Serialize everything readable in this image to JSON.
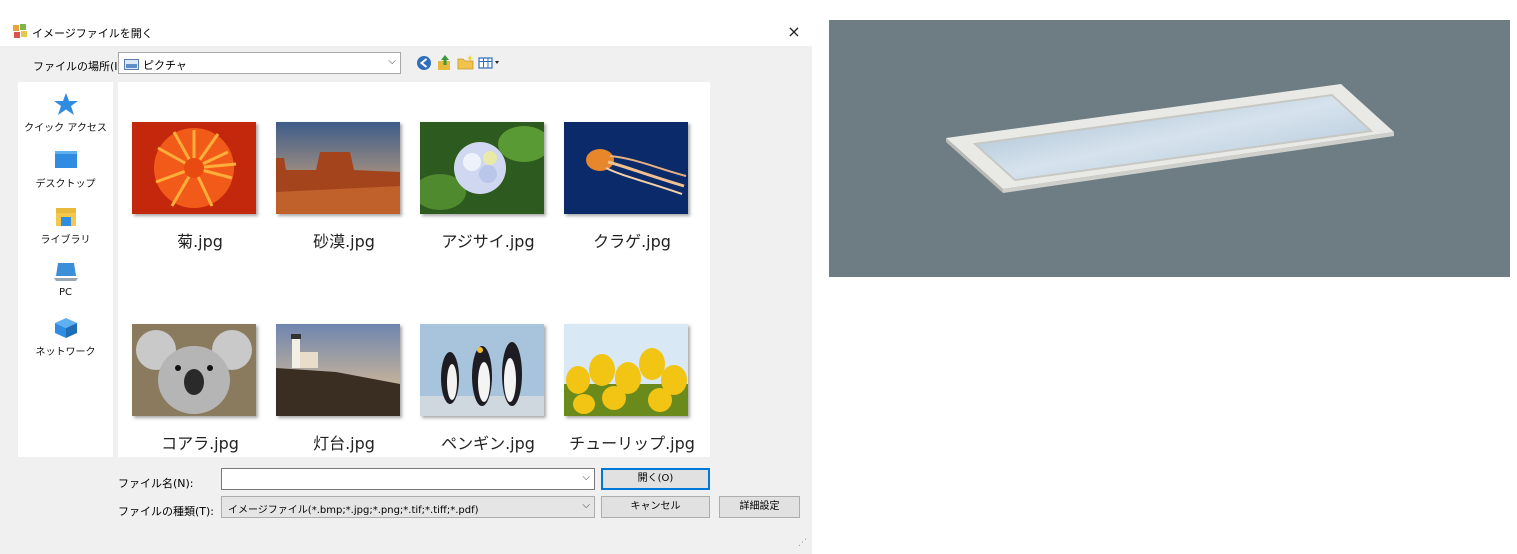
{
  "dialog": {
    "title": "イメージファイルを開く",
    "close_icon": "×",
    "look_in": {
      "label": "ファイルの場所(I):",
      "value": "ピクチャ",
      "icon": "pictures-folder-icon"
    },
    "toolbar_icons": [
      "back-icon",
      "up-folder-icon",
      "new-folder-icon",
      "view-menu-icon"
    ],
    "places": [
      {
        "label": "クイック アクセス",
        "icon": "star-icon"
      },
      {
        "label": "デスクトップ",
        "icon": "desktop-icon"
      },
      {
        "label": "ライブラリ",
        "icon": "library-icon"
      },
      {
        "label": "PC",
        "icon": "pc-icon"
      },
      {
        "label": "ネットワーク",
        "icon": "network-icon"
      }
    ],
    "files": [
      {
        "name": "菊.jpg"
      },
      {
        "name": "砂漠.jpg"
      },
      {
        "name": "アジサイ.jpg"
      },
      {
        "name": "クラゲ.jpg"
      },
      {
        "name": "コアラ.jpg"
      },
      {
        "name": "灯台.jpg"
      },
      {
        "name": "ペンギン.jpg"
      },
      {
        "name": "チューリップ.jpg"
      }
    ],
    "filename": {
      "label": "ファイル名(N):",
      "value": ""
    },
    "filetype": {
      "label": "ファイルの種類(T):",
      "value": "イメージファイル(*.bmp;*.jpg;*.png;*.tif;*.tiff;*.pdf)"
    },
    "buttons": {
      "open": "開く(O)",
      "cancel": "キャンセル",
      "advanced": "詳細設定"
    },
    "accent_color": "#0078d7"
  },
  "product_image": {
    "subject": "ceiling-light-fixture",
    "background": "#6e7d84"
  }
}
